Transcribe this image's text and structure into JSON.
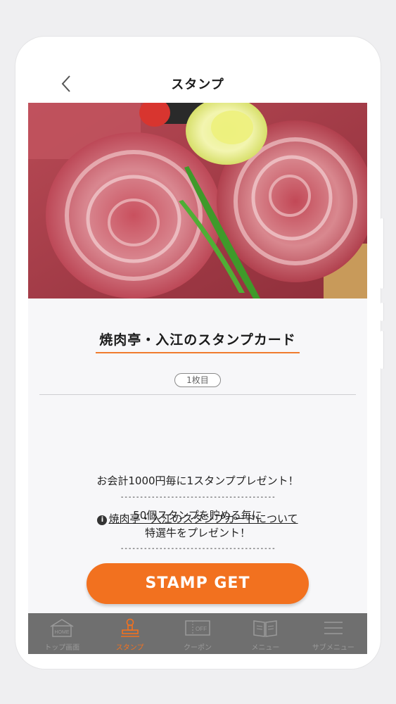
{
  "header": {
    "title": "スタンプ"
  },
  "card": {
    "title": "焼肉亭・入江のスタンプカード",
    "count_badge": "1枚目",
    "description_line1": "お会計1000円毎に1スタンププレゼント！",
    "separator": "----------------------------------------",
    "description_line2": "50個スタンプを貯める毎に",
    "description_line3": "特選牛をプレゼント！",
    "about_link": "焼肉亭・入江のスタンプカードについて",
    "stamp_button": "STAMP GET"
  },
  "tabbar": {
    "items": [
      {
        "label": "トップ画面",
        "icon": "home-icon",
        "icon_text": "HOME"
      },
      {
        "label": "スタンプ",
        "icon": "stamp-icon",
        "active": true
      },
      {
        "label": "クーポン",
        "icon": "coupon-icon",
        "icon_text": "OFF"
      },
      {
        "label": "メニュー",
        "icon": "book-icon"
      },
      {
        "label": "サブメニュー",
        "icon": "hamburger-icon"
      }
    ]
  },
  "colors": {
    "accent": "#f2711f",
    "tabbar_bg": "#6f6f6f",
    "tab_inactive": "#9a9a9a"
  }
}
